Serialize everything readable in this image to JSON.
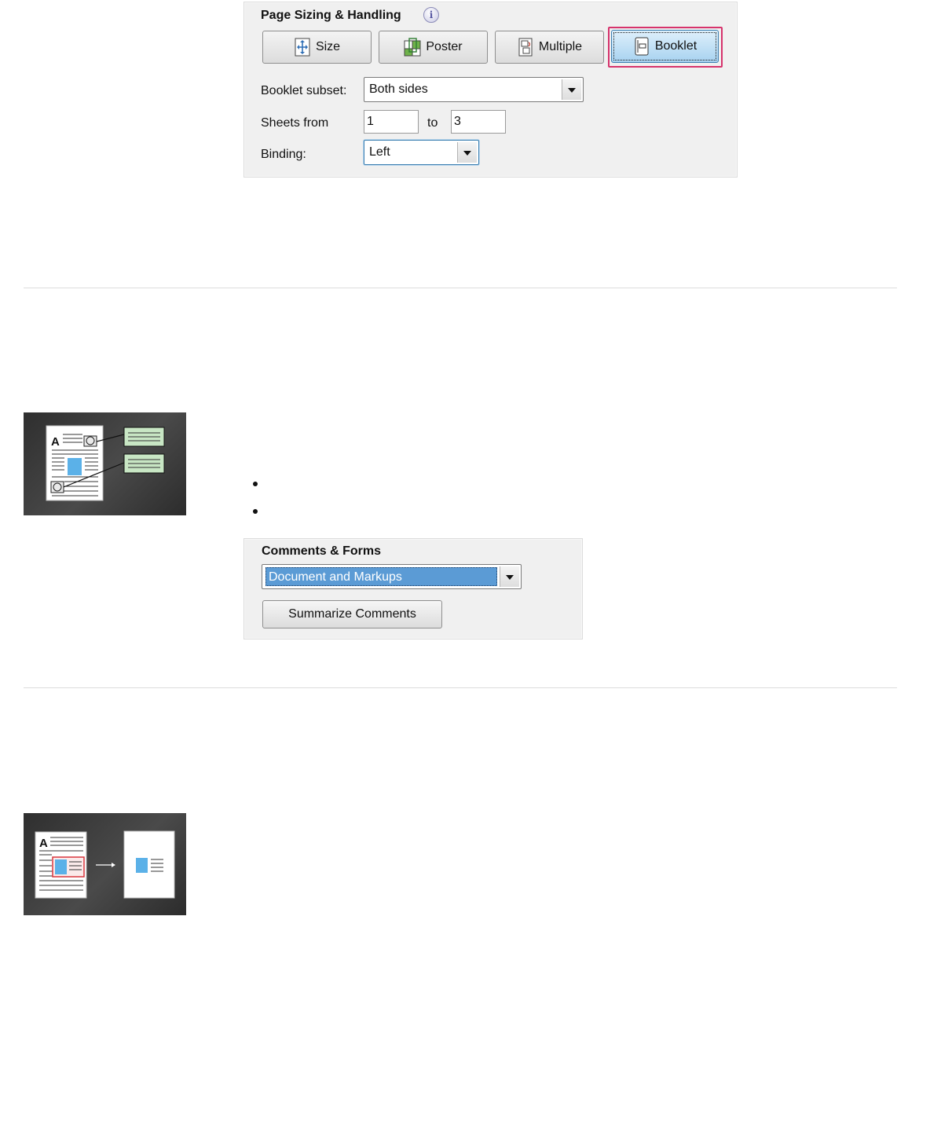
{
  "page_sizing": {
    "title": "Page Sizing & Handling",
    "info_glyph": "i",
    "buttons": [
      {
        "label": "Size",
        "icon": "size-icon"
      },
      {
        "label": "Poster",
        "icon": "poster-icon"
      },
      {
        "label": "Multiple",
        "icon": "multiple-icon"
      },
      {
        "label": "Booklet",
        "icon": "booklet-icon",
        "selected": true
      }
    ],
    "booklet_subset_label": "Booklet subset:",
    "booklet_subset_value": "Both sides",
    "sheets_from_label": "Sheets from",
    "sheets_from_value": "1",
    "to_label": "to",
    "sheets_to_value": "3",
    "binding_label": "Binding:",
    "binding_value": "Left"
  },
  "comments_forms": {
    "title": "Comments & Forms",
    "select_value": "Document and Markups",
    "summarize_button": "Summarize Comments"
  },
  "illustrations": {
    "comments_icon": "comments-illustration",
    "print-area_icon": "print-selection-illustration",
    "page_letter": "A"
  },
  "colors": {
    "accent_blue": "#5b9bd5",
    "selected_ring": "#d6336c",
    "panel_bg": "#f0f0f0"
  }
}
